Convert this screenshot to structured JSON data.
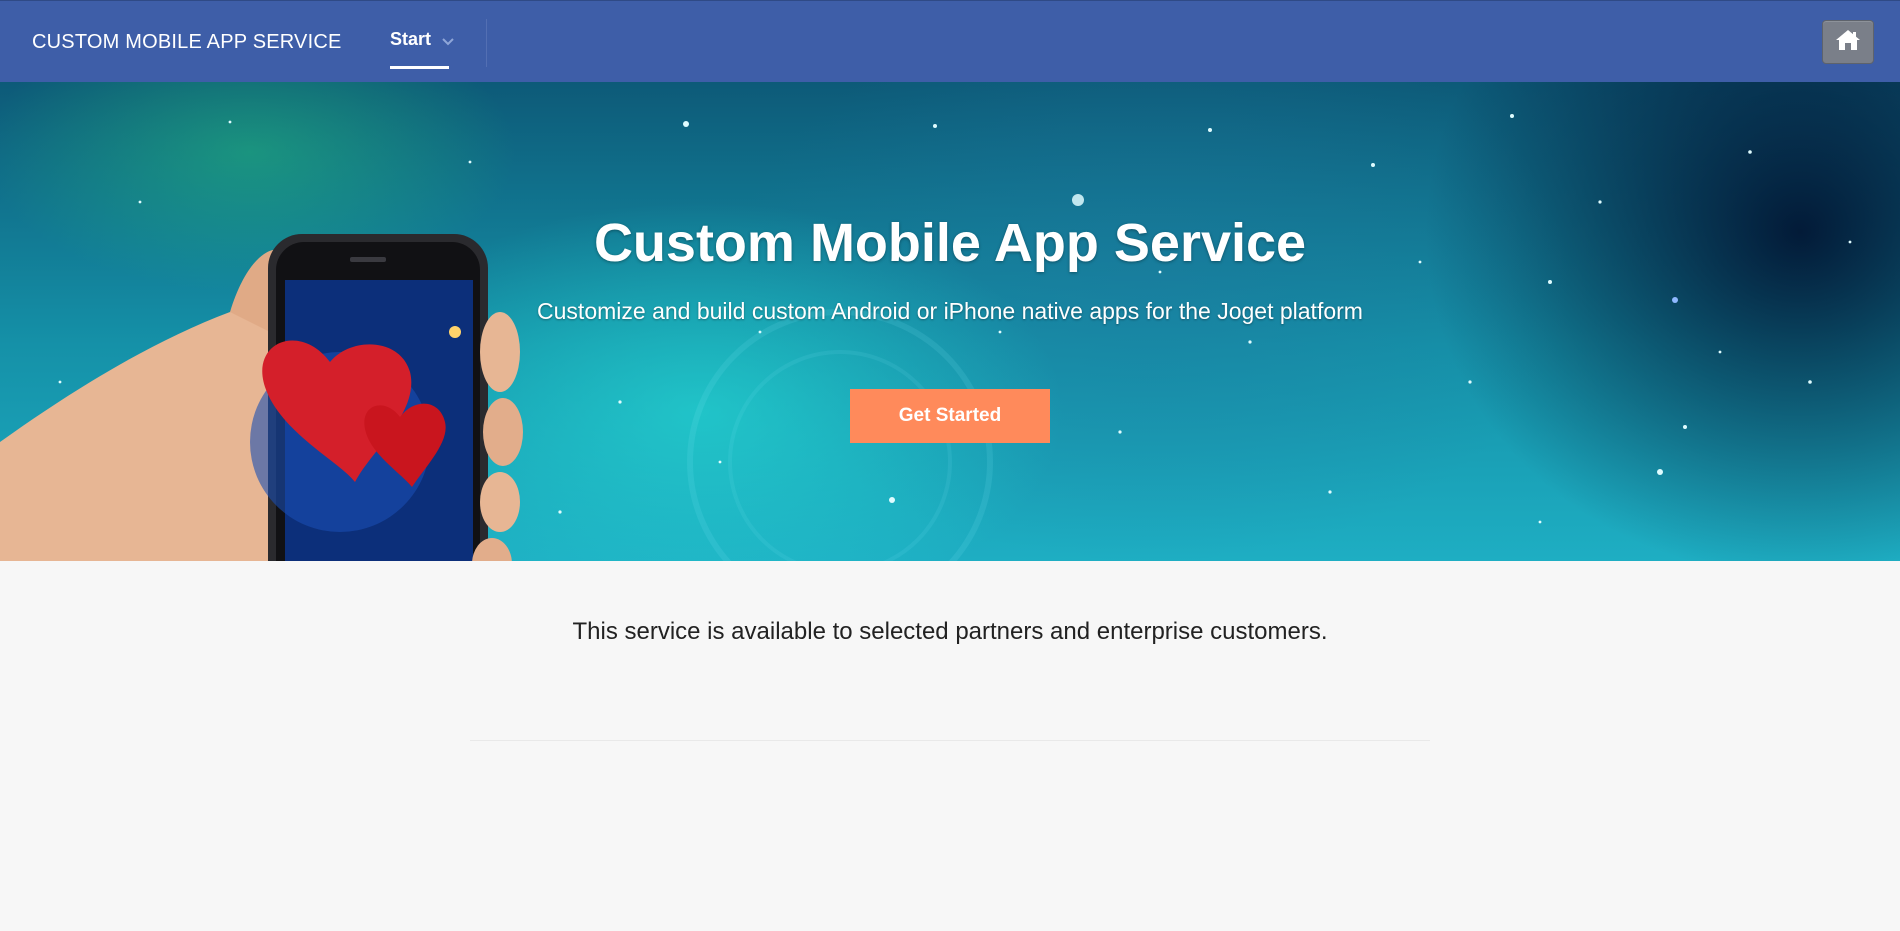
{
  "header": {
    "brand": "CUSTOM MOBILE APP SERVICE",
    "nav": {
      "start_label": "Start"
    },
    "home_button_icon": "home-icon"
  },
  "hero": {
    "title": "Custom Mobile App Service",
    "subtitle": "Customize and build custom Android or iPhone native apps for the Joget platform",
    "cta_label": "Get Started"
  },
  "content": {
    "notice": "This service is available to selected partners and enterprise customers."
  },
  "colors": {
    "nav_bg": "#3e5ea8",
    "cta_bg": "#ff8a5b",
    "page_bg": "#f7f7f7"
  }
}
